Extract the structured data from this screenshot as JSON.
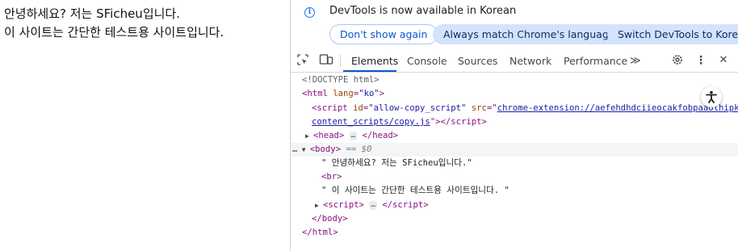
{
  "page": {
    "line1": "안녕하세요? 저는 SFicheu입니다.",
    "line2": "이 사이트는 간단한 테스트용 사이트입니다."
  },
  "infobar": {
    "message": "DevTools is now available in Korean",
    "buttons": [
      "Don't show again",
      "Always match Chrome's language",
      "Switch DevTools to Korean"
    ]
  },
  "toolbar": {
    "tabs": [
      "Elements",
      "Console",
      "Sources",
      "Network",
      "Performance"
    ],
    "more_tabs": "≫",
    "gear_icon": "gear-icon",
    "menu_icon": "⋮",
    "close_icon": "✕"
  },
  "tree": {
    "doctype": "<!DOCTYPE html>",
    "html_open_tag": "html",
    "html_attr": "lang",
    "html_val": "\"ko\"",
    "script_tag": "script",
    "script_id_attr": "id",
    "script_id_val": "\"allow-copy_script\"",
    "script_src_attr": "src",
    "script_src_val1": "chrome-extension://aefehdhdciieocakfobpaaolhipkcpgc/",
    "script_src_val2": "content_scripts/copy.js",
    "head_tag": "head",
    "body_tag": "body",
    "body_marker": "== $0",
    "text1": "\" 안녕하세요? 저는 SFicheu입니다.\"",
    "br_tag": "<br>",
    "text2": "\" 이 사이트는 간단한 테스트용 사이트입니다. \"",
    "script2_tag": "script",
    "body_close": "</body>",
    "html_close": "</html>",
    "ellipsis": "…",
    "more_marker": "…"
  },
  "colors": {
    "accent": "#0b57d0",
    "tag": "#881280",
    "attr": "#994500",
    "value": "#1a1aa6"
  }
}
